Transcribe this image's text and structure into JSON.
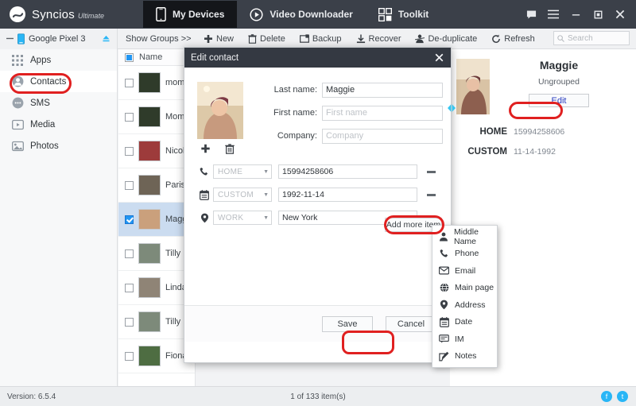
{
  "app": {
    "brand": "Syncios",
    "brand_edition": "Ultimate",
    "version_label": "Version: 6.5.4",
    "item_count": "1 of 133 item(s)"
  },
  "nav": {
    "tabs": [
      {
        "label": "My Devices",
        "icon": "phone-icon",
        "active": true
      },
      {
        "label": "Video Downloader",
        "icon": "play-circle-icon",
        "active": false
      },
      {
        "label": "Toolkit",
        "icon": "grid-squares-icon",
        "active": false
      }
    ],
    "window_controls": [
      {
        "name": "feedback-icon",
        "glyph": "⬜"
      },
      {
        "name": "menu-icon",
        "glyph": "≡"
      },
      {
        "name": "minimize-icon",
        "glyph": "—"
      },
      {
        "name": "maximize-icon",
        "glyph": "□"
      },
      {
        "name": "close-icon",
        "glyph": "✕"
      }
    ]
  },
  "toolbar": {
    "device_name": "Google Pixel 3",
    "show_groups": "Show Groups  >>",
    "actions": [
      {
        "label": "New",
        "icon": "plus-icon"
      },
      {
        "label": "Delete",
        "icon": "trash-icon"
      },
      {
        "label": "Backup",
        "icon": "backup-icon"
      },
      {
        "label": "Recover",
        "icon": "recover-icon"
      },
      {
        "label": "De-duplicate",
        "icon": "deduplicate-icon"
      },
      {
        "label": "Refresh",
        "icon": "refresh-icon"
      }
    ],
    "search_placeholder": "Search",
    "search_value": ""
  },
  "sidebar": {
    "items": [
      {
        "label": "Apps",
        "icon": "apps-grid-icon",
        "active": false
      },
      {
        "label": "Contacts",
        "icon": "contacts-person-icon",
        "active": true
      },
      {
        "label": "SMS",
        "icon": "sms-bubble-icon",
        "active": false
      },
      {
        "label": "Media",
        "icon": "media-film-icon",
        "active": false
      },
      {
        "label": "Photos",
        "icon": "photos-image-icon",
        "active": false
      }
    ]
  },
  "contact_list": {
    "header_label": "Name",
    "rows": [
      {
        "name": "mom",
        "checked": false,
        "selected": false,
        "thumb": "#2f3b2a"
      },
      {
        "name": "Mom",
        "checked": false,
        "selected": false,
        "thumb": "#2f3b2a"
      },
      {
        "name": "Nicole",
        "checked": false,
        "selected": false,
        "thumb": "#9d3b3b"
      },
      {
        "name": "Paris",
        "checked": false,
        "selected": false,
        "thumb": "#6e6456"
      },
      {
        "name": "Maggie",
        "checked": true,
        "selected": true,
        "thumb": "#caa07c"
      },
      {
        "name": "Tilly",
        "checked": false,
        "selected": false,
        "thumb": "#7d8a7a"
      },
      {
        "name": "Linda",
        "checked": false,
        "selected": false,
        "thumb": "#8f8476"
      },
      {
        "name": "Tilly",
        "checked": false,
        "selected": false,
        "thumb": "#7d8a7a"
      },
      {
        "name": "Fiona",
        "checked": false,
        "selected": false,
        "thumb": "#4e6d42"
      }
    ]
  },
  "detail": {
    "name": "Maggie",
    "group": "Ungrouped",
    "edit_label": "Edit",
    "fields": [
      {
        "label": "HOME",
        "value": "15994258606"
      },
      {
        "label": "CUSTOM",
        "value": "11-14-1992"
      }
    ]
  },
  "dialog": {
    "title": "Edit contact",
    "tooltip": "Edit contact",
    "photo_add_icon": "plus-icon",
    "photo_delete_icon": "trash-icon",
    "swap_icon": "swap-arrows-icon",
    "name_fields": [
      {
        "label": "Last name:",
        "value": "Maggie",
        "placeholder": "Last name"
      },
      {
        "label": "First name:",
        "value": "",
        "placeholder": "First name"
      },
      {
        "label": "Company:",
        "value": "",
        "placeholder": "Company"
      }
    ],
    "item_rows": [
      {
        "icon": "phone-icon",
        "type": "HOME",
        "value": "15994258606"
      },
      {
        "icon": "calendar-icon",
        "type": "CUSTOM",
        "value": "1992-11-14"
      },
      {
        "icon": "location-pin-icon",
        "type": "WORK",
        "value": "New York"
      }
    ],
    "add_more_label": "Add more item",
    "save_label": "Save",
    "cancel_label": "Cancel"
  },
  "dropdown": {
    "items": [
      {
        "label": "Middle Name",
        "icon": "person-icon"
      },
      {
        "label": "Phone",
        "icon": "phone-icon"
      },
      {
        "label": "Email",
        "icon": "envelope-icon"
      },
      {
        "label": "Main page",
        "icon": "globe-icon"
      },
      {
        "label": "Address",
        "icon": "location-pin-icon"
      },
      {
        "label": "Date",
        "icon": "calendar-icon"
      },
      {
        "label": "IM",
        "icon": "chat-icon"
      },
      {
        "label": "Notes",
        "icon": "note-pencil-icon"
      }
    ]
  },
  "colors": {
    "titlebar": "#3b4049",
    "active_tab": "#14161a",
    "accent_blue": "#2196f3",
    "selection": "#cbdcf0",
    "annotation_red": "#e02020",
    "link_blue": "#2a3ec0"
  }
}
